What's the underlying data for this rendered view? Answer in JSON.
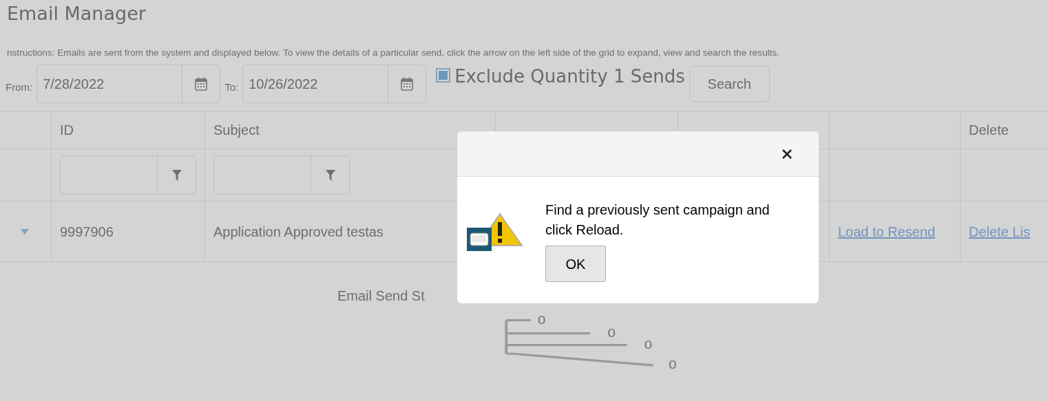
{
  "page": {
    "title": "Email Manager",
    "instructions": "nstructions: Emails are sent from the system and displayed below. To view the details of a particular send, click the arrow on the left side of the grid to expand, view and search the results."
  },
  "filters": {
    "from_label": "From:",
    "from_value": "7/28/2022",
    "to_label": "To:",
    "to_value": "10/26/2022",
    "exclude": {
      "label": "Exclude Quantity 1 Sends",
      "checked": true
    },
    "search_button": "Search"
  },
  "grid": {
    "id_heading": "ID",
    "subject_heading": "Subject",
    "delete_heading": "Delete",
    "rows": [
      {
        "expanded": true,
        "id": "9997906",
        "subject": "Application Approved testas",
        "resend_link": "Load to Resend",
        "delete_link": "Delete Lis"
      }
    ]
  },
  "chart": {
    "title": "Email Send St",
    "labels": [
      "0",
      "0",
      "0",
      "0"
    ]
  },
  "dialog": {
    "message": "Find a previously sent campaign and click Reload.",
    "button": "OK"
  }
}
